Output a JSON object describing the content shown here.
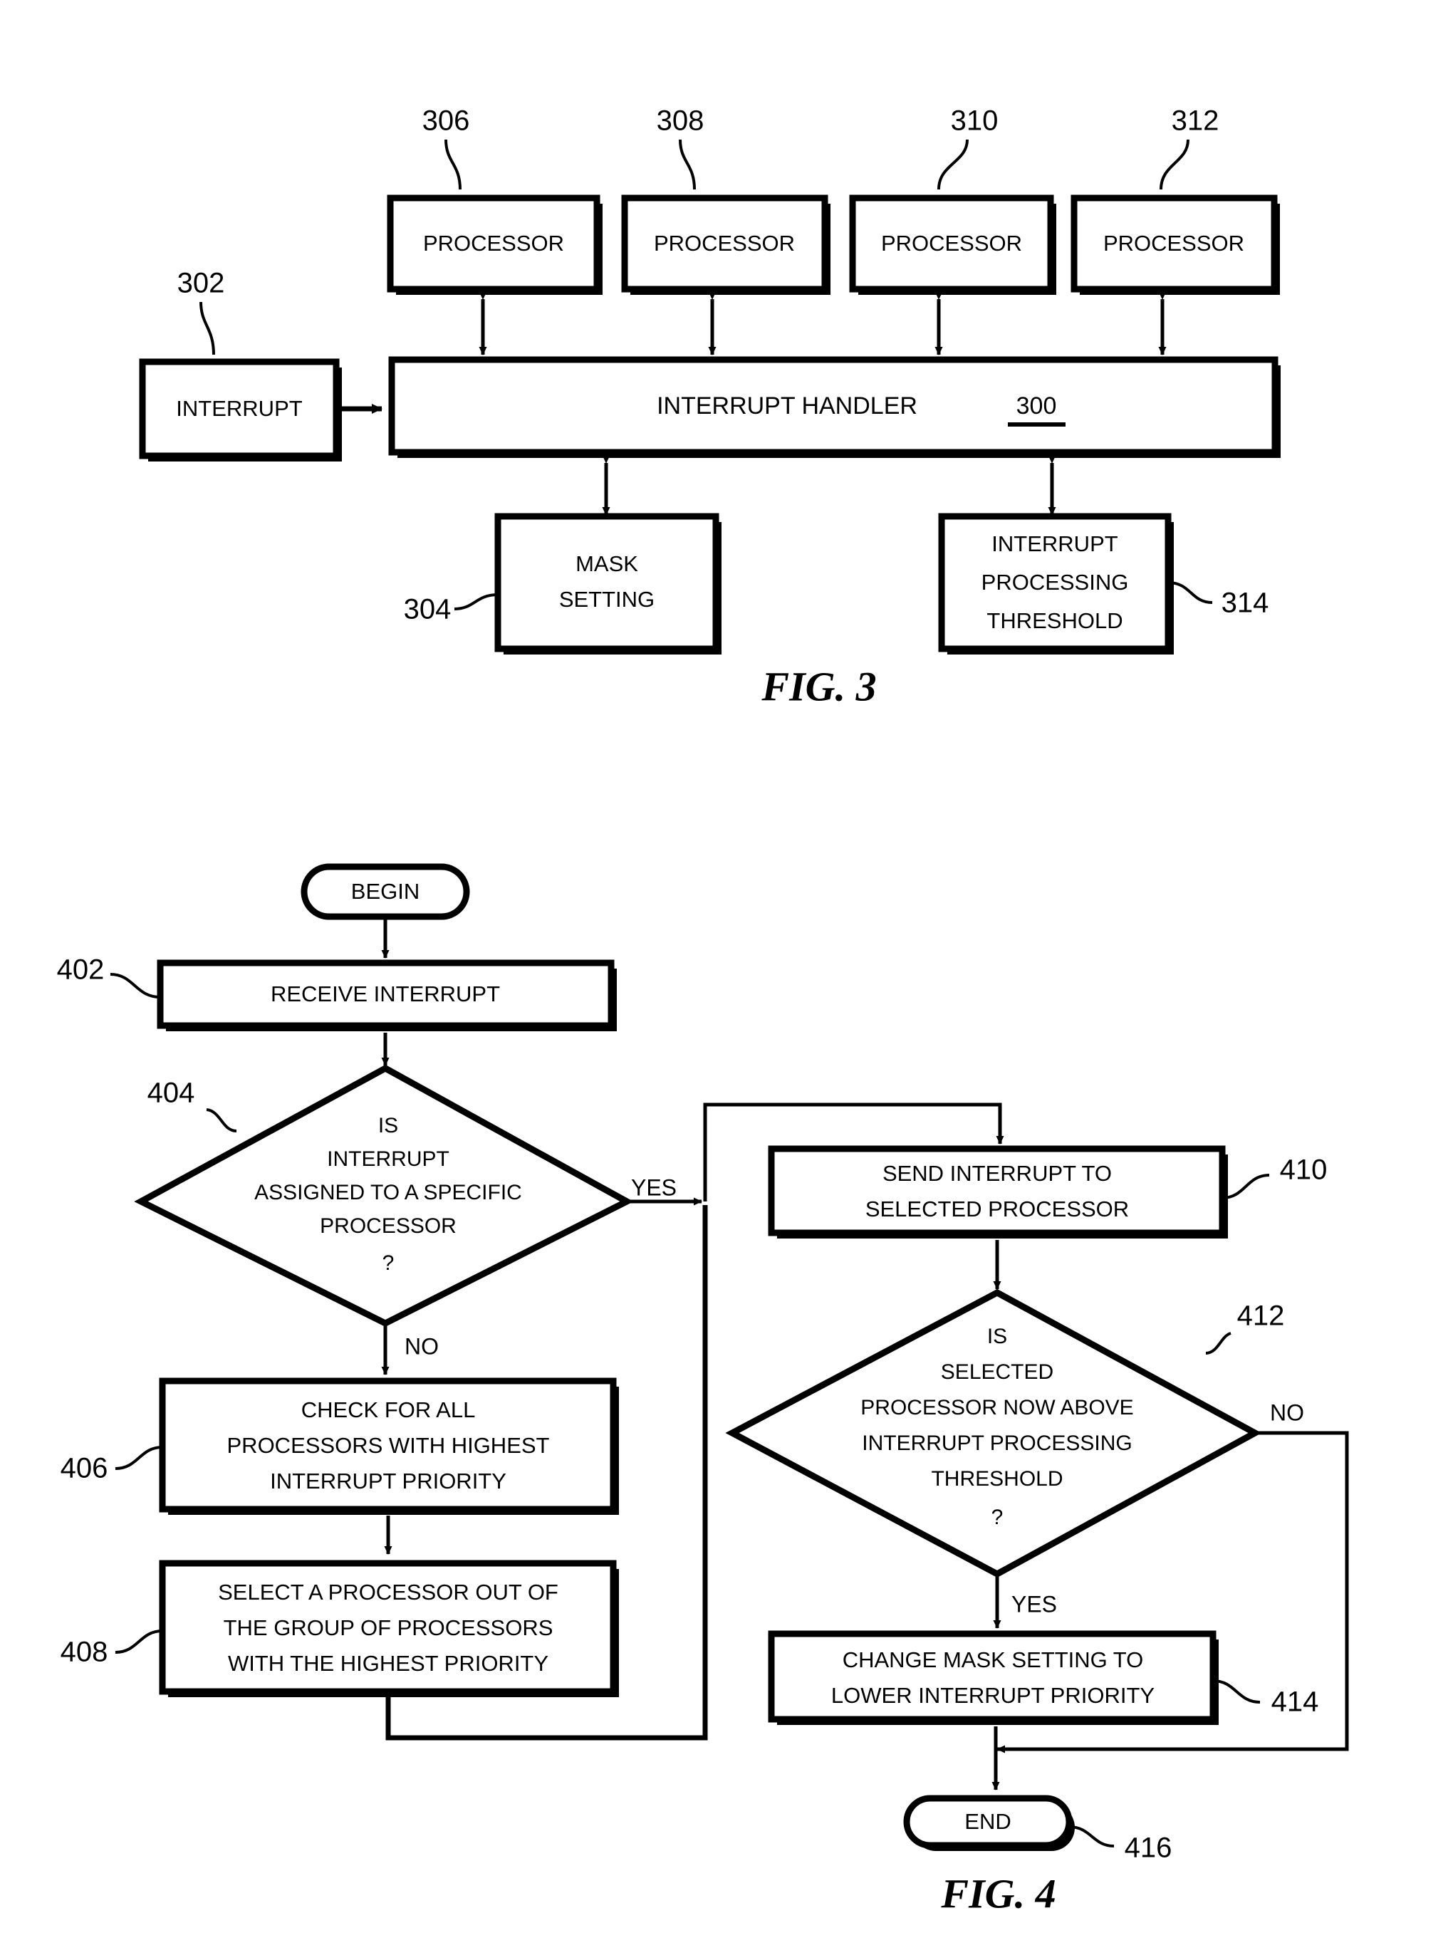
{
  "document": {
    "type": "patent-drawing-sheet"
  },
  "fig3": {
    "caption": "FIG. 3",
    "handler": {
      "label": "INTERRUPT HANDLER",
      "ref": "300"
    },
    "interrupt": {
      "label": "INTERRUPT",
      "ref": "302"
    },
    "processors": [
      {
        "label": "PROCESSOR",
        "ref": "306"
      },
      {
        "label": "PROCESSOR",
        "ref": "308"
      },
      {
        "label": "PROCESSOR",
        "ref": "310"
      },
      {
        "label": "PROCESSOR",
        "ref": "312"
      }
    ],
    "mask_setting": {
      "line1": "MASK",
      "line2": "SETTING",
      "ref": "304"
    },
    "threshold": {
      "line1": "INTERRUPT",
      "line2": "PROCESSING",
      "line3": "THRESHOLD",
      "ref": "314"
    }
  },
  "fig4": {
    "caption": "FIG. 4",
    "begin": {
      "label": "BEGIN"
    },
    "end": {
      "label": "END",
      "ref": "416"
    },
    "steps": [
      {
        "ref": "402",
        "kind": "process",
        "lines": [
          "RECEIVE INTERRUPT"
        ]
      },
      {
        "ref": "404",
        "kind": "decision",
        "lines": [
          "IS",
          "INTERRUPT",
          "ASSIGNED TO A SPECIFIC",
          "PROCESSOR",
          "?"
        ],
        "yes_label": "YES",
        "no_label": "NO"
      },
      {
        "ref": "406",
        "kind": "process",
        "lines": [
          "CHECK FOR ALL",
          "PROCESSORS WITH HIGHEST",
          "INTERRUPT PRIORITY"
        ]
      },
      {
        "ref": "408",
        "kind": "process",
        "lines": [
          "SELECT A PROCESSOR OUT OF",
          "THE GROUP OF PROCESSORS",
          "WITH THE HIGHEST PRIORITY"
        ]
      },
      {
        "ref": "410",
        "kind": "process",
        "lines": [
          "SEND INTERRUPT TO",
          "SELECTED PROCESSOR"
        ]
      },
      {
        "ref": "412",
        "kind": "decision",
        "lines": [
          "IS",
          "SELECTED",
          "PROCESSOR NOW ABOVE",
          "INTERRUPT PROCESSING",
          "THRESHOLD",
          "?"
        ],
        "yes_label": "YES",
        "no_label": "NO"
      },
      {
        "ref": "414",
        "kind": "process",
        "lines": [
          "CHANGE MASK SETTING TO",
          "LOWER INTERRUPT PRIORITY"
        ]
      }
    ]
  },
  "colors": {
    "ink": "#000000",
    "paper": "#ffffff"
  }
}
